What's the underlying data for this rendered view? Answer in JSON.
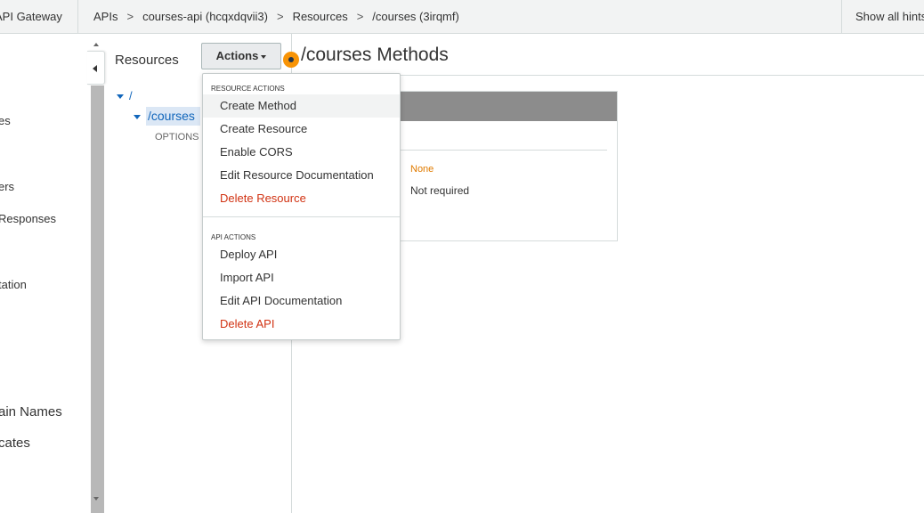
{
  "topbar": {
    "brand": "API Gateway",
    "crumbs": [
      "APIs",
      "courses-api (hcqxdqvii3)",
      "Resources",
      "/courses (3irqmf)"
    ],
    "separator": ">",
    "hints": "Show all hints"
  },
  "leftnav": {
    "items": [
      "es",
      "ers",
      "Responses",
      "tation",
      "ain Names",
      "cates"
    ]
  },
  "resources": {
    "title": "Resources",
    "actions_label": "Actions",
    "root": "/",
    "selected": "/courses",
    "child_method": "OPTIONS"
  },
  "main": {
    "title": "/courses Methods",
    "auth_value": "None",
    "api_key_value": "Not required"
  },
  "dropdown": {
    "resource_header": "RESOURCE ACTIONS",
    "resource_items": [
      "Create Method",
      "Create Resource",
      "Enable CORS",
      "Edit Resource Documentation",
      "Delete Resource"
    ],
    "api_header": "API ACTIONS",
    "api_items": [
      "Deploy API",
      "Import API",
      "Edit API Documentation",
      "Delete API"
    ]
  },
  "colors": {
    "accent_orange": "#f89406",
    "danger": "#d13212",
    "link": "#1166bb"
  }
}
